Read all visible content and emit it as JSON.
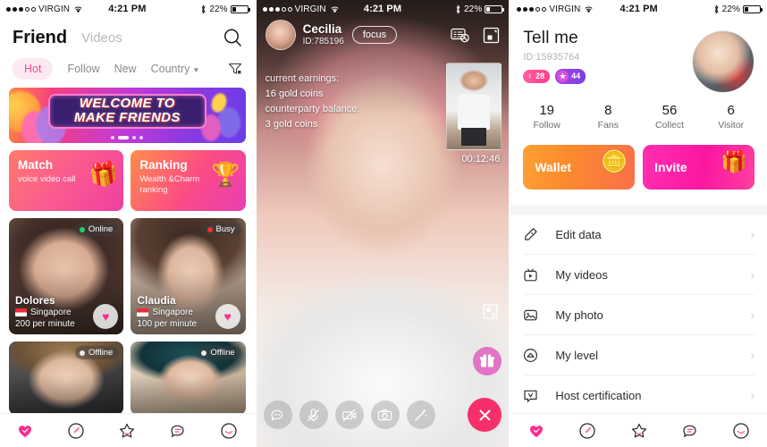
{
  "status_bar": {
    "carrier": "VIRGIN",
    "time": "4:21 PM",
    "battery": "22%",
    "signal_dots_filled": 3,
    "signal_dots_total": 5,
    "wifi_icon": "wifi-icon",
    "bluetooth_icon": "bluetooth-icon"
  },
  "screen_friend": {
    "title": "Friend",
    "secondary_title": "Videos",
    "search_icon": "search-icon",
    "filter_icon": "filter-icon",
    "tabs": [
      {
        "label": "Hot",
        "active": true
      },
      {
        "label": "Follow",
        "active": false
      },
      {
        "label": "New",
        "active": false
      },
      {
        "label": "Country",
        "active": false,
        "has_caret": true
      }
    ],
    "banner": {
      "line1": "WELCOME TO",
      "line2": "MAKE FRIENDS",
      "dots": 4,
      "active_dot": 2
    },
    "features": [
      {
        "title": "Match",
        "subtitle": "voice video call",
        "icon": "gift-box-icon"
      },
      {
        "title": "Ranking",
        "subtitle": "Wealth &Charm ranking",
        "icon": "trophy-icon"
      }
    ],
    "users": [
      {
        "name": "Dolores",
        "country": "Singapore",
        "rate": "200 per minute",
        "status": "Online",
        "status_color": "#23d160"
      },
      {
        "name": "Claudia",
        "country": "Singapore",
        "rate": "100 per minute",
        "status": "Busy",
        "status_color": "#ff2d2d"
      },
      {
        "name": "",
        "country": "",
        "rate": "",
        "status": "Offline",
        "status_color": "#e9e9e9"
      },
      {
        "name": "",
        "country": "",
        "rate": "",
        "status": "Offline",
        "status_color": "#e9e9e9"
      }
    ],
    "bottom_nav": [
      {
        "name": "heart-icon",
        "active": true
      },
      {
        "name": "compass-icon",
        "active": false
      },
      {
        "name": "star-icon",
        "active": false
      },
      {
        "name": "chat-icon",
        "active": false
      },
      {
        "name": "smiley-icon",
        "active": false
      }
    ]
  },
  "screen_call": {
    "name": "Cecilia",
    "id": "ID:785196",
    "focus_label": "focus",
    "header_icons": [
      {
        "name": "block-messages-icon"
      },
      {
        "name": "minimize-screen-icon"
      }
    ],
    "earnings_label": "current earnings:",
    "earnings_value": "16 gold coins",
    "balance_label": "counterparty balance:",
    "balance_value": "3 gold coins",
    "timer": "00:12:46",
    "pip_expand_icon": "pip-expand-icon",
    "gift_icon": "gift-icon",
    "controls": [
      {
        "name": "chat-bubble-icon"
      },
      {
        "name": "mic-muted-icon"
      },
      {
        "name": "camera-off-icon"
      },
      {
        "name": "switch-camera-icon"
      },
      {
        "name": "beauty-wand-icon"
      },
      {
        "name": "end-call-icon"
      }
    ]
  },
  "screen_profile": {
    "name": "Tell me",
    "id": "ID:15935764",
    "avatar_name": "profile-avatar",
    "badges": [
      {
        "icon": "female-icon",
        "value": "28",
        "color": "#ff3d8a"
      },
      {
        "icon": "star-level-icon",
        "value": "44",
        "color": "#7b3fe4"
      }
    ],
    "stats": [
      {
        "value": "19",
        "label": "Follow"
      },
      {
        "value": "8",
        "label": "Fans"
      },
      {
        "value": "56",
        "label": "Collect"
      },
      {
        "value": "6",
        "label": "Visitor"
      }
    ],
    "actions": [
      {
        "label": "Wallet",
        "icon": "gold-coins-icon",
        "color": "#fb8b2e"
      },
      {
        "label": "Invite",
        "icon": "gift-open-icon",
        "color": "#fb17a0"
      }
    ],
    "menu": [
      {
        "label": "Edit data",
        "icon": "pencil-icon"
      },
      {
        "label": "My videos",
        "icon": "video-icon"
      },
      {
        "label": "My photo",
        "icon": "photo-icon"
      },
      {
        "label": "My level",
        "icon": "level-icon"
      },
      {
        "label": "Host certification",
        "icon": "certification-icon"
      }
    ],
    "bottom_nav": [
      {
        "name": "heart-icon",
        "active": true
      },
      {
        "name": "compass-icon",
        "active": false
      },
      {
        "name": "star-icon",
        "active": false
      },
      {
        "name": "chat-icon",
        "active": false
      },
      {
        "name": "smiley-icon",
        "active": false
      }
    ]
  }
}
